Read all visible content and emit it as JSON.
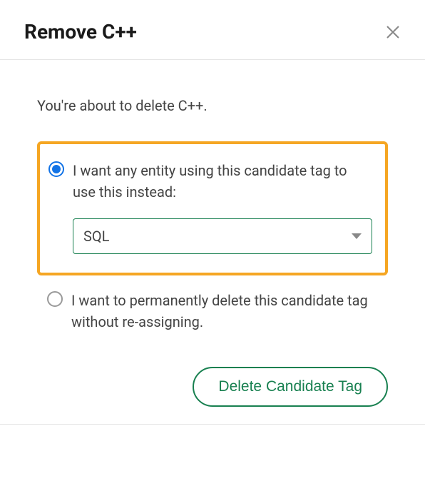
{
  "header": {
    "title": "Remove C++"
  },
  "body": {
    "intro": "You're about to delete C++.",
    "option1": {
      "label": "I want any entity using this candidate tag to use this instead:",
      "selected": true,
      "replacement_value": "SQL"
    },
    "option2": {
      "label": "I want to permanently delete this candidate tag without re-assigning.",
      "selected": false
    }
  },
  "actions": {
    "delete_label": "Delete Candidate Tag"
  }
}
